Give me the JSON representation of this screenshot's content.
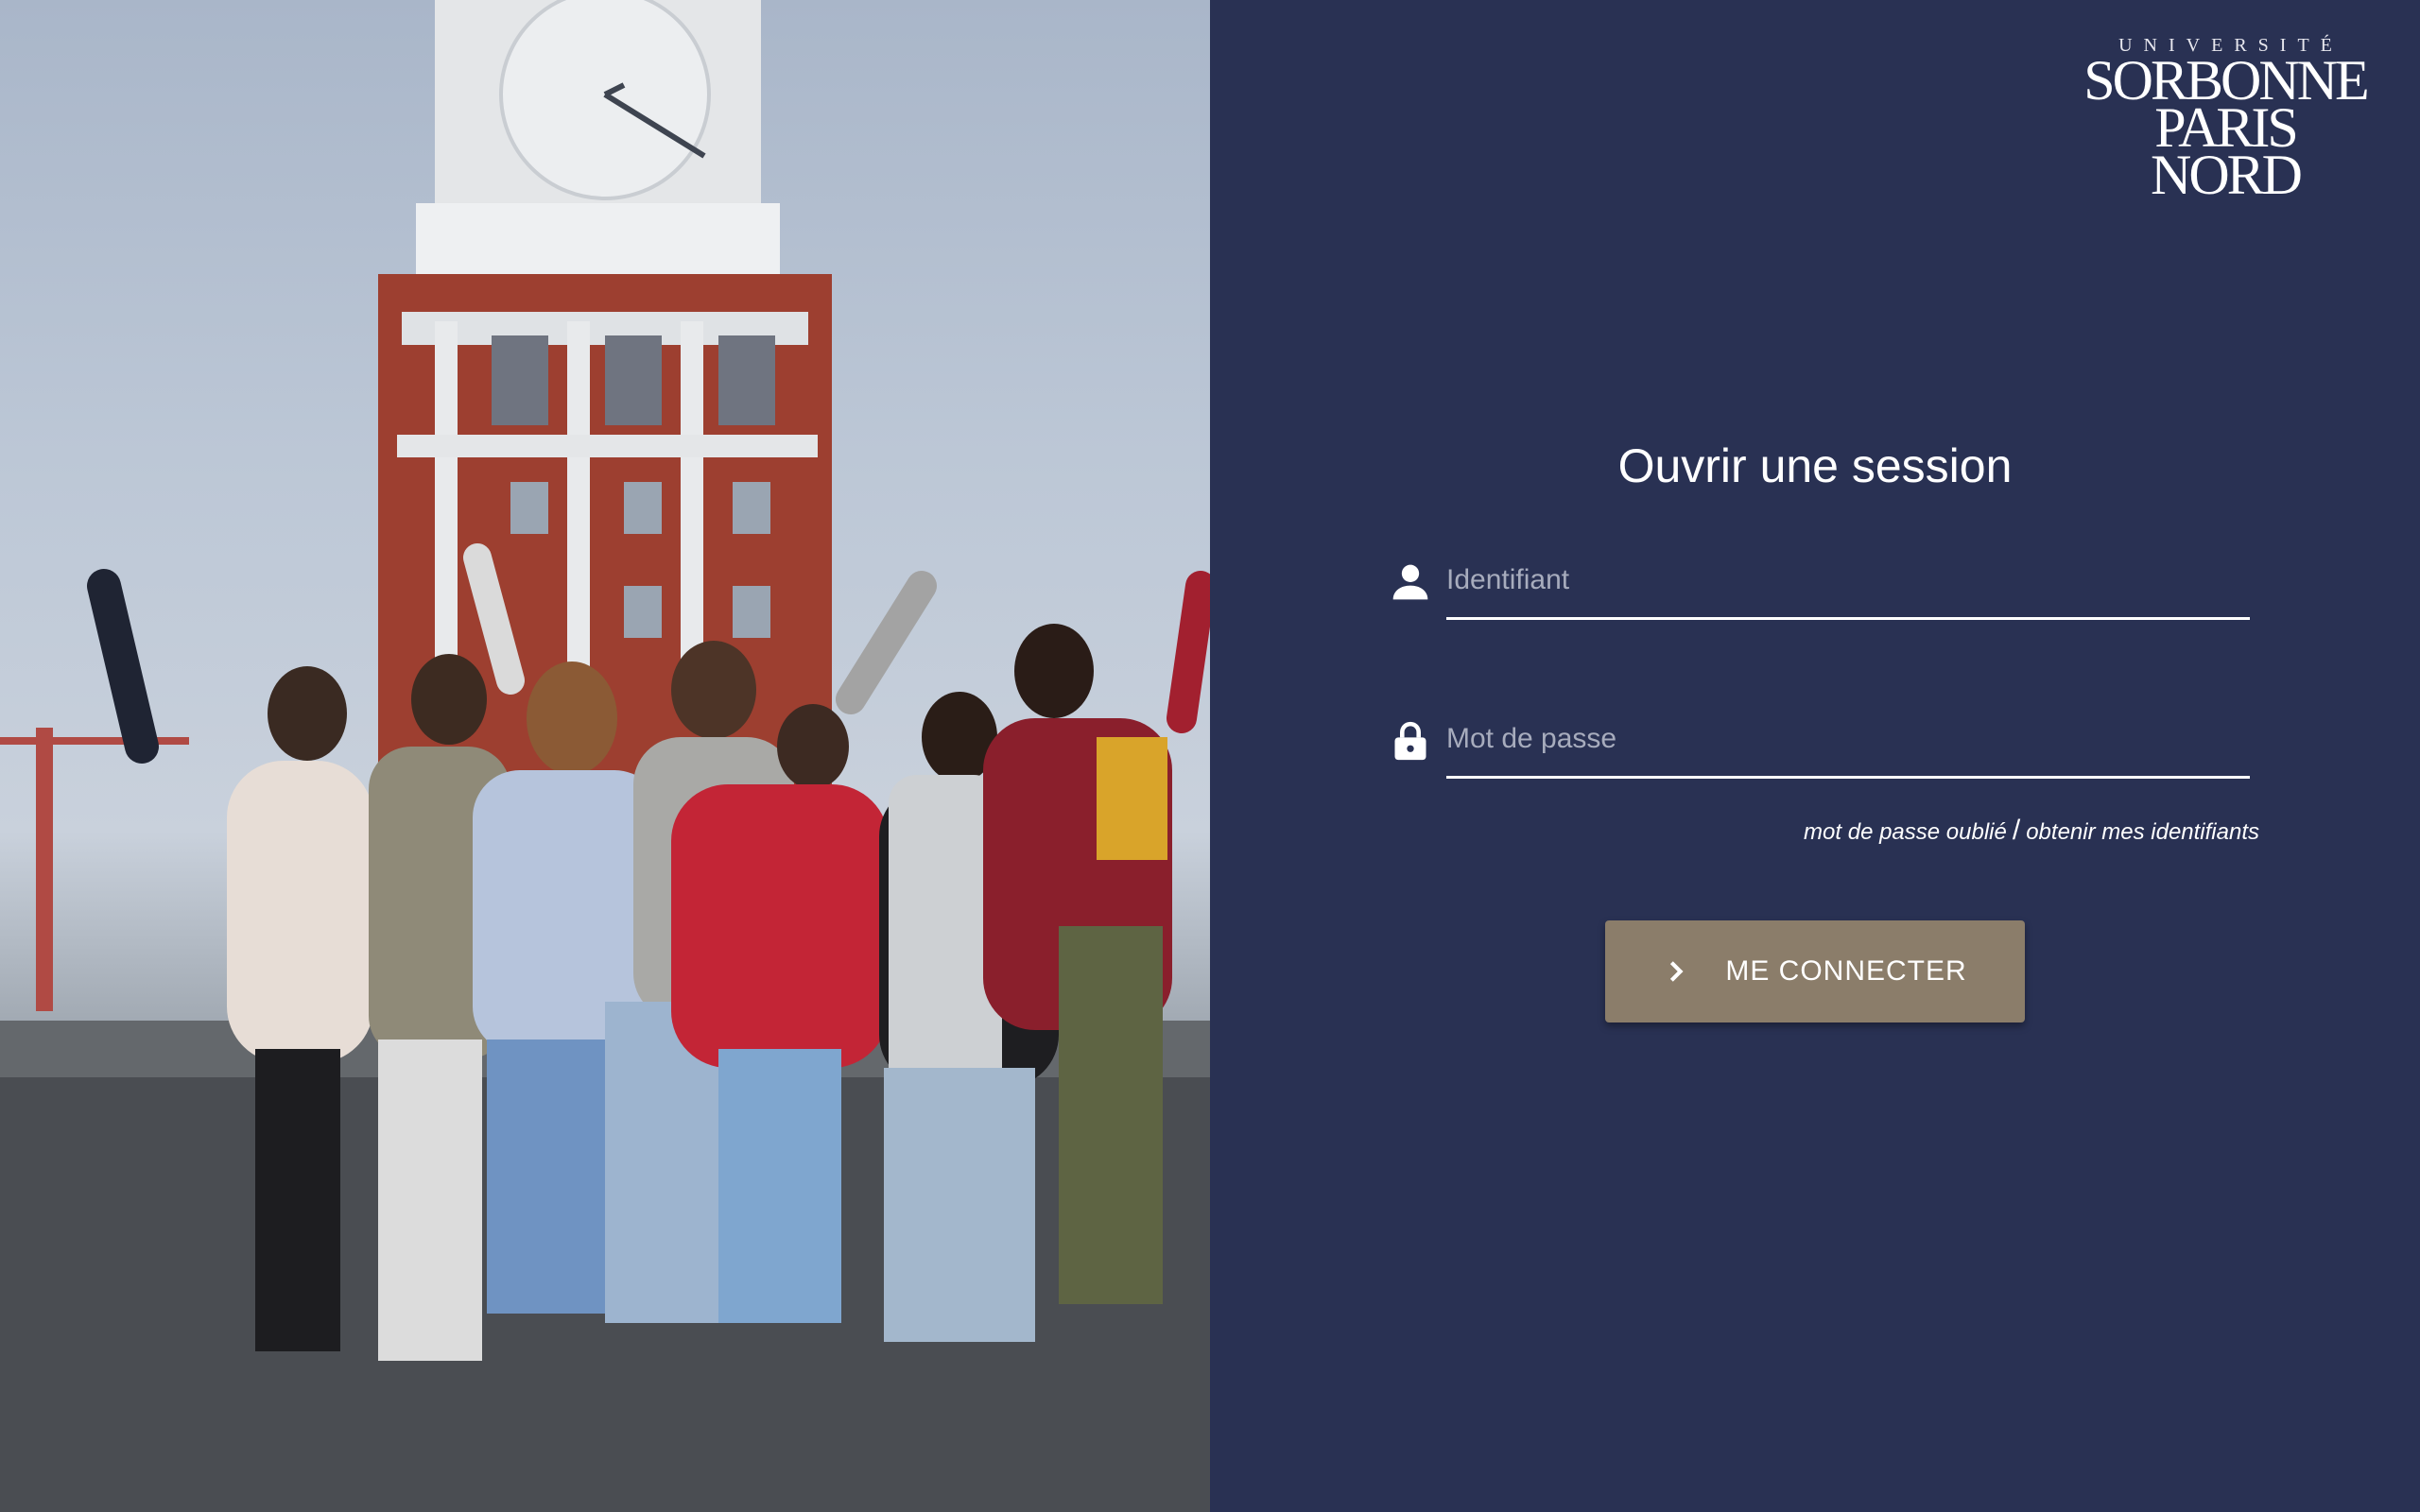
{
  "photo": {
    "alt_scene": ""
  },
  "logo": {
    "top_line": "UNIVERSITÉ",
    "line1": "SORBONNE",
    "line2": "PARIS NORD"
  },
  "login": {
    "title": "Ouvrir une session",
    "username_placeholder": "Identifiant",
    "password_placeholder": "Mot de passe",
    "forgot_password": "mot de passe oublié",
    "separator": "/",
    "get_credentials": "obtenir mes identifiants",
    "submit_label": "ME CONNECTER"
  },
  "icons": {
    "username": "user-icon",
    "password": "lock-icon",
    "submit": "chevron-right-icon"
  },
  "colors": {
    "panel_background": "#293153",
    "button_background": "#8b7d6a",
    "text": "#ffffff"
  }
}
